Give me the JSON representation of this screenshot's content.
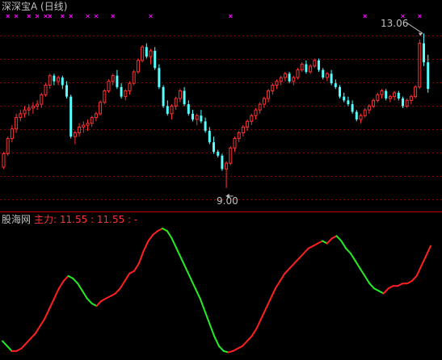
{
  "window": {
    "title": "深深宝A (日线)"
  },
  "colors": {
    "background": "#000000",
    "up_candle": "#ff3232",
    "down_candle": "#54ffff",
    "grid": "#8b0000",
    "signal_marker": "#ff00ff",
    "indicator_up": "#ff2020",
    "indicator_down": "#22ee22",
    "text": "#c0c0c0"
  },
  "price_panel": {
    "high_label": "13.06",
    "low_label": "9.00"
  },
  "indicator_panel": {
    "name": "股海网",
    "values_text": "主力: 11.55 : 11.55 : -"
  },
  "chart_data": [
    {
      "type": "candlestick",
      "title": "深深宝A (日线)",
      "ylim": [
        8.85,
        13.3
      ],
      "grid": true,
      "candles": [
        [
          9.55,
          9.95,
          9.5,
          9.9
        ],
        [
          9.9,
          10.35,
          9.85,
          10.3
        ],
        [
          10.3,
          10.65,
          10.2,
          10.55
        ],
        [
          10.55,
          10.95,
          10.45,
          10.85
        ],
        [
          10.85,
          11.05,
          10.75,
          10.95
        ],
        [
          10.95,
          11.15,
          10.85,
          11.05
        ],
        [
          11.05,
          11.2,
          10.9,
          11.1
        ],
        [
          11.1,
          11.25,
          10.95,
          11.15
        ],
        [
          11.15,
          11.3,
          11.05,
          11.2
        ],
        [
          11.2,
          11.5,
          11.1,
          11.45
        ],
        [
          11.45,
          11.75,
          11.4,
          11.7
        ],
        [
          11.7,
          12.0,
          11.6,
          11.95
        ],
        [
          11.95,
          12.0,
          11.7,
          11.8
        ],
        [
          11.8,
          11.95,
          11.7,
          11.9
        ],
        [
          11.9,
          11.95,
          11.6,
          11.7
        ],
        [
          11.7,
          11.8,
          11.35,
          11.4
        ],
        [
          11.4,
          11.45,
          10.3,
          10.35
        ],
        [
          10.35,
          10.5,
          10.15,
          10.45
        ],
        [
          10.45,
          10.7,
          10.35,
          10.6
        ],
        [
          10.6,
          10.75,
          10.45,
          10.65
        ],
        [
          10.65,
          10.8,
          10.5,
          10.7
        ],
        [
          10.7,
          10.9,
          10.6,
          10.85
        ],
        [
          10.85,
          11.0,
          10.75,
          10.95
        ],
        [
          10.95,
          11.3,
          10.9,
          11.25
        ],
        [
          11.25,
          11.6,
          11.2,
          11.55
        ],
        [
          11.55,
          11.85,
          11.5,
          11.8
        ],
        [
          11.8,
          12.0,
          11.7,
          11.95
        ],
        [
          11.95,
          12.1,
          11.6,
          11.65
        ],
        [
          11.65,
          11.75,
          11.35,
          11.4
        ],
        [
          11.4,
          11.6,
          11.3,
          11.55
        ],
        [
          11.55,
          11.8,
          11.45,
          11.75
        ],
        [
          11.75,
          12.1,
          11.7,
          12.05
        ],
        [
          12.05,
          12.4,
          12.0,
          12.35
        ],
        [
          12.35,
          12.75,
          12.3,
          12.7
        ],
        [
          12.7,
          12.8,
          12.4,
          12.45
        ],
        [
          12.45,
          12.65,
          12.25,
          12.6
        ],
        [
          12.6,
          12.7,
          12.1,
          12.15
        ],
        [
          12.15,
          12.25,
          11.6,
          11.65
        ],
        [
          11.65,
          11.7,
          11.1,
          11.15
        ],
        [
          11.15,
          11.3,
          10.9,
          10.95
        ],
        [
          10.95,
          11.2,
          10.8,
          11.15
        ],
        [
          11.15,
          11.4,
          11.05,
          11.35
        ],
        [
          11.35,
          11.6,
          11.25,
          11.55
        ],
        [
          11.55,
          11.65,
          11.15,
          11.2
        ],
        [
          11.2,
          11.3,
          10.9,
          10.95
        ],
        [
          10.95,
          11.05,
          10.75,
          10.8
        ],
        [
          10.8,
          10.95,
          10.65,
          10.9
        ],
        [
          10.9,
          11.05,
          10.7,
          10.75
        ],
        [
          10.75,
          10.85,
          10.45,
          10.5
        ],
        [
          10.5,
          10.6,
          10.15,
          10.2
        ],
        [
          10.2,
          10.35,
          9.9,
          9.95
        ],
        [
          9.95,
          10.0,
          9.8,
          9.85
        ],
        [
          9.85,
          9.9,
          9.45,
          9.5
        ],
        [
          9.5,
          9.7,
          9.0,
          9.65
        ],
        [
          9.65,
          10.1,
          9.6,
          10.05
        ],
        [
          10.05,
          10.35,
          9.95,
          10.3
        ],
        [
          10.3,
          10.5,
          10.2,
          10.45
        ],
        [
          10.45,
          10.65,
          10.35,
          10.6
        ],
        [
          10.6,
          10.8,
          10.5,
          10.75
        ],
        [
          10.75,
          10.95,
          10.65,
          10.9
        ],
        [
          10.9,
          11.1,
          10.8,
          11.05
        ],
        [
          11.05,
          11.25,
          10.95,
          11.2
        ],
        [
          11.2,
          11.4,
          11.1,
          11.35
        ],
        [
          11.35,
          11.6,
          11.25,
          11.55
        ],
        [
          11.55,
          11.75,
          11.45,
          11.7
        ],
        [
          11.7,
          11.85,
          11.6,
          11.8
        ],
        [
          11.8,
          11.95,
          11.7,
          11.9
        ],
        [
          11.9,
          12.05,
          11.8,
          12.0
        ],
        [
          12.0,
          12.05,
          11.75,
          11.8
        ],
        [
          11.8,
          11.95,
          11.7,
          11.9
        ],
        [
          11.9,
          12.15,
          11.85,
          12.1
        ],
        [
          12.1,
          12.3,
          12.05,
          12.25
        ],
        [
          12.25,
          12.35,
          12.0,
          12.05
        ],
        [
          12.05,
          12.25,
          12.0,
          12.2
        ],
        [
          12.2,
          12.4,
          12.15,
          12.35
        ],
        [
          12.35,
          12.4,
          12.05,
          12.1
        ],
        [
          12.1,
          12.15,
          11.85,
          11.9
        ],
        [
          11.9,
          12.05,
          11.8,
          12.0
        ],
        [
          12.0,
          12.1,
          11.7,
          11.75
        ],
        [
          11.75,
          11.85,
          11.6,
          11.65
        ],
        [
          11.65,
          11.7,
          11.35,
          11.4
        ],
        [
          11.4,
          11.5,
          11.25,
          11.3
        ],
        [
          11.3,
          11.4,
          11.15,
          11.2
        ],
        [
          11.2,
          11.3,
          10.95,
          11.0
        ],
        [
          11.0,
          11.05,
          10.75,
          10.8
        ],
        [
          10.8,
          10.95,
          10.7,
          10.9
        ],
        [
          10.9,
          11.1,
          10.85,
          11.05
        ],
        [
          11.05,
          11.2,
          10.95,
          11.15
        ],
        [
          11.15,
          11.35,
          11.1,
          11.3
        ],
        [
          11.3,
          11.5,
          11.25,
          11.45
        ],
        [
          11.45,
          11.6,
          11.35,
          11.55
        ],
        [
          11.55,
          11.6,
          11.3,
          11.35
        ],
        [
          11.35,
          11.45,
          11.25,
          11.4
        ],
        [
          11.4,
          11.55,
          11.3,
          11.5
        ],
        [
          11.5,
          11.55,
          11.3,
          11.35
        ],
        [
          11.35,
          11.4,
          11.1,
          11.15
        ],
        [
          11.15,
          11.35,
          11.1,
          11.3
        ],
        [
          11.3,
          11.45,
          11.2,
          11.4
        ],
        [
          11.4,
          11.7,
          11.35,
          11.65
        ],
        [
          11.65,
          12.9,
          11.6,
          12.8
        ],
        [
          12.8,
          13.06,
          12.2,
          12.3
        ],
        [
          12.3,
          12.5,
          11.5,
          11.6
        ]
      ],
      "annotations": [
        {
          "text": "13.06",
          "kind": "period-high"
        },
        {
          "text": "9.00",
          "kind": "period-low"
        }
      ],
      "signal_markers": [
        1,
        3,
        6,
        8,
        10,
        11,
        14,
        16,
        20,
        22,
        26,
        35,
        54,
        86,
        95,
        99
      ]
    },
    {
      "type": "line",
      "title": "股海网",
      "series": [
        {
          "name": "主力",
          "values": [
            0.1,
            0.06,
            0.02,
            0.02,
            0.04,
            0.08,
            0.12,
            0.16,
            0.22,
            0.28,
            0.36,
            0.44,
            0.52,
            0.58,
            0.62,
            0.6,
            0.56,
            0.5,
            0.44,
            0.4,
            0.38,
            0.42,
            0.44,
            0.46,
            0.48,
            0.52,
            0.58,
            0.64,
            0.66,
            0.72,
            0.82,
            0.9,
            0.95,
            0.98,
            1.0,
            0.98,
            0.92,
            0.84,
            0.76,
            0.68,
            0.6,
            0.52,
            0.44,
            0.34,
            0.24,
            0.14,
            0.06,
            0.02,
            0.01,
            0.02,
            0.04,
            0.06,
            0.1,
            0.14,
            0.2,
            0.28,
            0.36,
            0.44,
            0.52,
            0.58,
            0.64,
            0.68,
            0.72,
            0.76,
            0.8,
            0.84,
            0.86,
            0.88,
            0.9,
            0.88,
            0.92,
            0.94,
            0.9,
            0.84,
            0.8,
            0.74,
            0.68,
            0.62,
            0.56,
            0.52,
            0.5,
            0.48,
            0.52,
            0.54,
            0.54,
            0.56,
            0.56,
            0.58,
            0.62,
            0.7,
            0.78,
            0.86
          ]
        }
      ],
      "values_text": "主力: 11.55 : 11.55 : -",
      "grid": false
    }
  ]
}
